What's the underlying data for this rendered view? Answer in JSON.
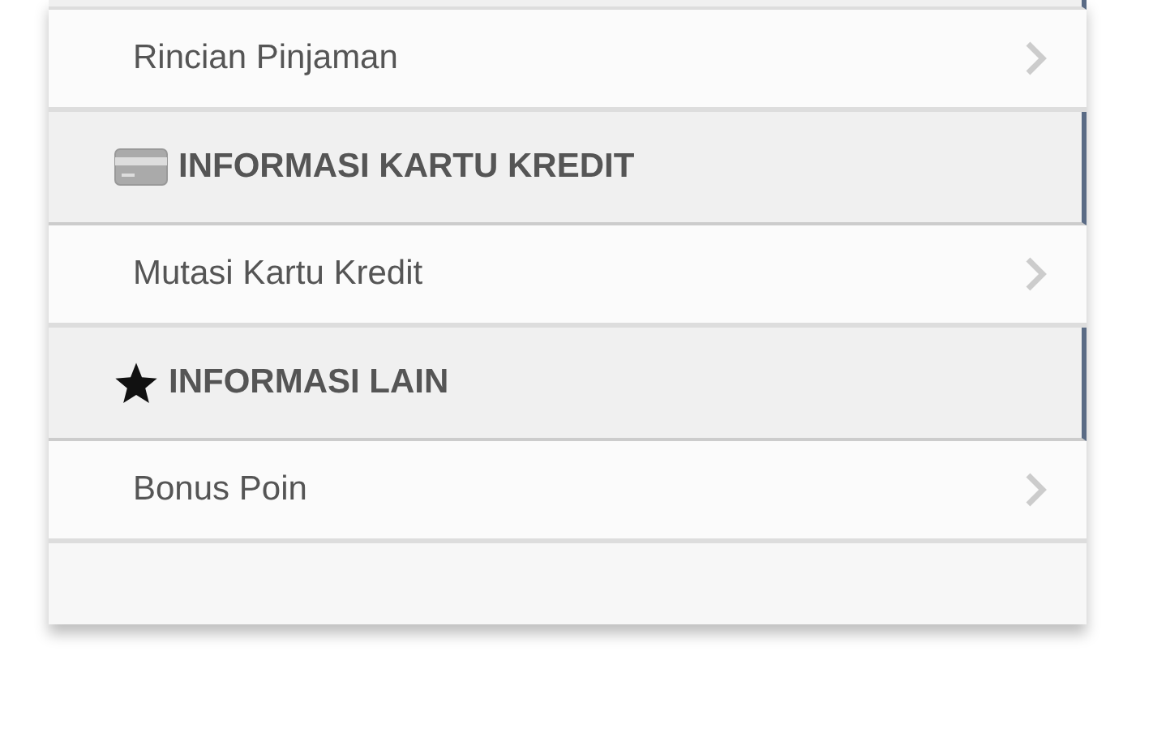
{
  "menu": [
    {
      "kind": "item",
      "label": "Rincian Pinjaman"
    },
    {
      "kind": "header",
      "title": "INFORMASI KARTU KREDIT"
    },
    {
      "kind": "item",
      "label": "Mutasi Kartu Kredit"
    },
    {
      "kind": "header",
      "title": "INFORMASI LAIN"
    },
    {
      "kind": "item",
      "label": "Bonus Poin"
    }
  ]
}
